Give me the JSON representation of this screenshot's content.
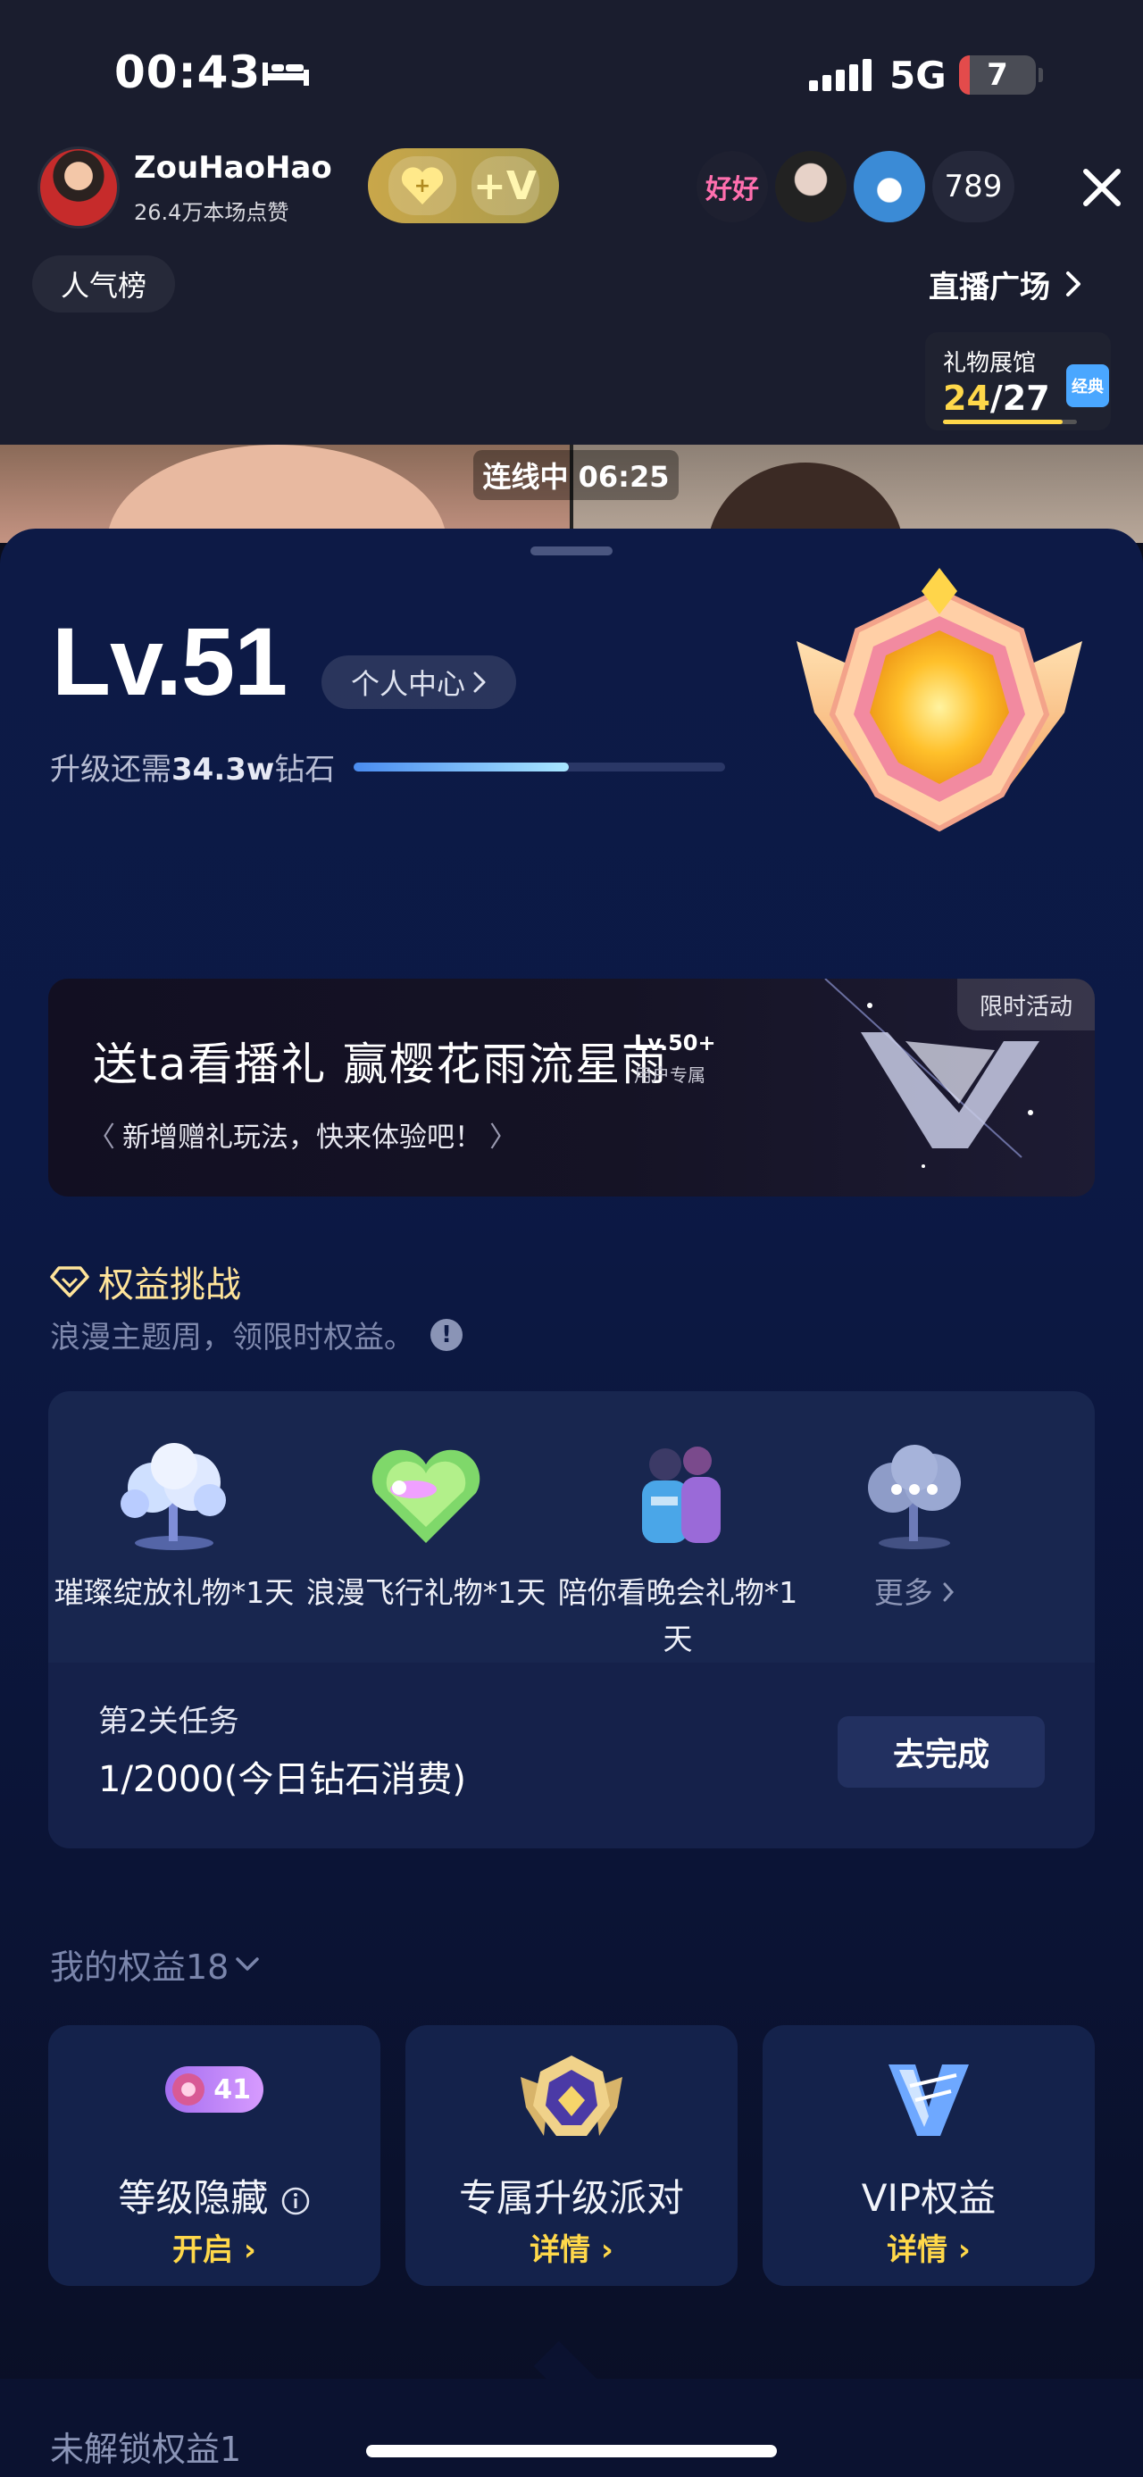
{
  "status_bar": {
    "time": "00:43",
    "network": "5G",
    "battery": "7"
  },
  "host": {
    "name": "ZouHaoHao",
    "likes": "26.4万本场点赞",
    "badge_plus": "+",
    "badge_v": "+V"
  },
  "viewers": {
    "avatar1_text": "好好",
    "count": "789"
  },
  "nav": {
    "rank": "人气榜",
    "plaza": "直播广场"
  },
  "gift_hall": {
    "title": "礼物展馆",
    "current": "24",
    "total": "/27",
    "tag": "经典",
    "progress": 0.89
  },
  "link": {
    "label": "连线中 06:25"
  },
  "level": {
    "title": "Lv.51",
    "personal_center": "个人中心",
    "upgrade_prefix": "升级还需",
    "upgrade_amount": "34.3w",
    "upgrade_suffix": "钻石",
    "progress": 0.58
  },
  "banner": {
    "tag": "限时活动",
    "title": "送ta看播礼 赢樱花雨流星雨",
    "lv": "Lv.50+",
    "lv_sub": "用户专属",
    "subtitle": "新增赠礼玩法，快来体验吧！"
  },
  "challenge": {
    "title": "权益挑战",
    "subtitle": "浪漫主题周，领限时权益。",
    "rewards": [
      {
        "label": "璀璨绽放礼物*1天"
      },
      {
        "label": "浪漫飞行礼物*1天"
      },
      {
        "label": "陪你看晚会礼物*1天"
      },
      {
        "label": "更多"
      }
    ],
    "task_title": "第2关任务",
    "task_progress": "1/2000(今日钻石消费)",
    "task_button": "去完成"
  },
  "my_rights": {
    "title": "我的权益18",
    "cards": [
      {
        "title": "等级隐藏",
        "link": "开启",
        "pill": "41"
      },
      {
        "title": "专属升级派对",
        "link": "详情"
      },
      {
        "title": "VIP权益",
        "link": "详情"
      }
    ]
  },
  "locked": {
    "title": "未解锁权益1"
  },
  "colors": {
    "gold": "#ffd84a",
    "sheet_bg": "#0d1a46",
    "card_bg": "#14224b"
  }
}
